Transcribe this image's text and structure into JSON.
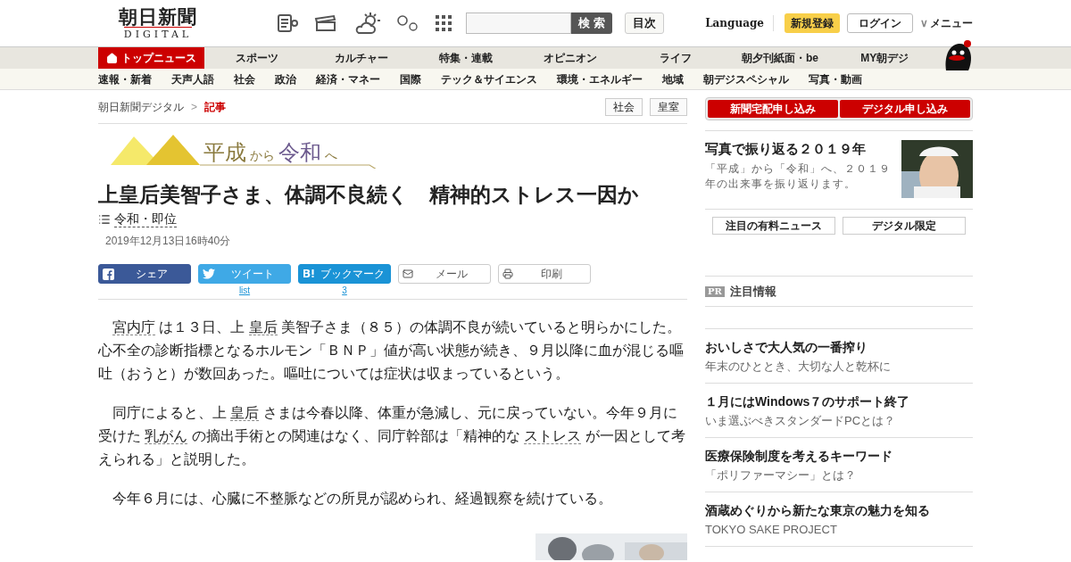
{
  "header": {
    "logo_main": "朝日新聞",
    "logo_sub": "DIGITAL",
    "search_button": "検 索",
    "index_button": "目次",
    "language": "Language",
    "register": "新規登録",
    "login": "ログイン",
    "menu_caret": "∨",
    "menu": "メニュー"
  },
  "nav": [
    {
      "label": "トップニュース",
      "selected": true
    },
    {
      "label": "スポーツ",
      "selected": false
    },
    {
      "label": "カルチャー",
      "selected": false
    },
    {
      "label": "特集・連載",
      "selected": false
    },
    {
      "label": "オピニオン",
      "selected": false
    },
    {
      "label": "ライフ",
      "selected": false
    },
    {
      "label": "朝夕刊紙面・be",
      "selected": false
    },
    {
      "label": "MY朝デジ",
      "selected": false
    }
  ],
  "subnav": [
    "速報・新着",
    "天声人語",
    "社会",
    "政治",
    "経済・マネー",
    "国際",
    "テック＆サイエンス",
    "環境・エネルギー",
    "地域",
    "朝デジスペシャル",
    "写真・動画"
  ],
  "breadcrumb": {
    "items": [
      "朝日新聞デジタル",
      "記事"
    ],
    "separator": ">"
  },
  "tags": [
    "社会",
    "皇室"
  ],
  "banner": {
    "parts": [
      "平成",
      "から",
      "令和",
      "へ"
    ]
  },
  "article": {
    "title": "上皇后美智子さま、体調不良続く　精神的ストレス一因か",
    "category": "令和・即位",
    "date": "2019年12月13日16時40分",
    "share": [
      {
        "kind": "facebook",
        "label": "シェア"
      },
      {
        "kind": "twitter",
        "label": "ツイート",
        "count": "list"
      },
      {
        "kind": "hatena",
        "label": "ブックマーク",
        "count": "3"
      },
      {
        "kind": "mail",
        "label": "メール"
      },
      {
        "kind": "print",
        "label": "印刷"
      }
    ],
    "paragraphs": [
      [
        {
          "kind": "term",
          "text": "宮内庁"
        },
        {
          "kind": "text",
          "text": " は１３日、上 "
        },
        {
          "kind": "term",
          "text": "皇后"
        },
        {
          "kind": "text",
          "text": " 美智子さま（８５）の体調不良が続いていると明らかにした。心不全の診断指標となるホルモン「ＢＮＰ」値が高い状態が続き、９月以降に血が混じる嘔吐（おうと）が数回あった。嘔吐については症状は収まっているという。"
        }
      ],
      [
        {
          "kind": "text",
          "text": "同庁によると、上 "
        },
        {
          "kind": "term",
          "text": "皇后"
        },
        {
          "kind": "text",
          "text": " さまは今春以降、体重が急減し、元に戻っていない。今年９月に受けた "
        },
        {
          "kind": "term",
          "text": "乳がん"
        },
        {
          "kind": "text",
          "text": " の摘出手術との関連はなく、同庁幹部は「精神的な "
        },
        {
          "kind": "term",
          "text": "ストレス"
        },
        {
          "kind": "text",
          "text": " が一因として考えられる」と説明した。"
        }
      ],
      [
        {
          "kind": "text",
          "text": "今年６月には、心臓に不整脈などの所見が認められ、経過観察を続けている。"
        }
      ]
    ]
  },
  "sidebar": {
    "subscribe": [
      "新聞宅配申し込み",
      "デジタル申し込み"
    ],
    "feature": {
      "title": "写真で振り返る２０１９年",
      "text": "「平成」から「令和」へ、２０１９年の出来事を振り返ります。"
    },
    "buttons": [
      "注目の有料ニュース",
      "デジタル限定"
    ],
    "pr": {
      "badge": "PR",
      "title": "注目情報"
    },
    "items": [
      {
        "title": "おいしさで大人気の一番搾り",
        "sub": "年末のひととき、大切な人と乾杯に"
      },
      {
        "title": "１月にはWindows７のサポート終了",
        "sub": "いま選ぶべきスタンダードPCとは？"
      },
      {
        "title": "医療保険制度を考えるキーワード",
        "sub": "「ポリファーマシー」とは？"
      },
      {
        "title": "酒蔵めぐりから新たな東京の魅力を知る",
        "sub": "TOKYO SAKE PROJECT"
      }
    ]
  }
}
